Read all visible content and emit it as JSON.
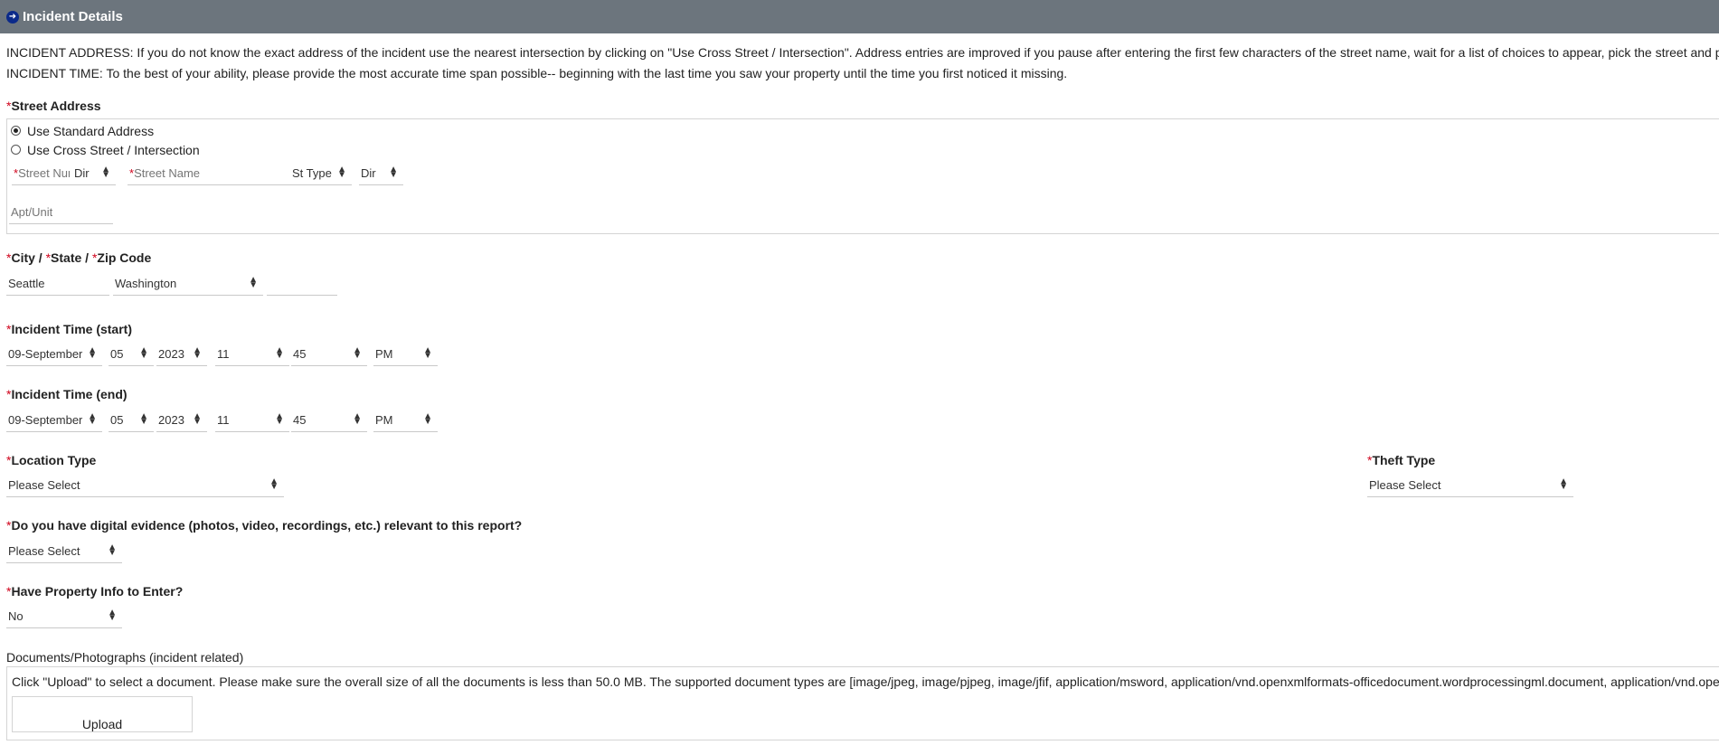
{
  "section": {
    "title": "Incident Details",
    "icon": "arrow-right-circle-icon"
  },
  "instructions": {
    "address": "INCIDENT ADDRESS: If you do not know the exact address of the incident use the nearest intersection by clicking on \"Use Cross Street / Intersection\". Address entries are improved if you pause after entering the first few characters of the street name, wait for a list of choices to appear, pick the street and press ENTER.",
    "time": "INCIDENT TIME: To the best of your ability, please provide the most accurate time span possible-- beginning with the last time you saw your property until the time you first noticed it missing."
  },
  "required_marker": "*",
  "street_address": {
    "label": "Street Address",
    "options": [
      {
        "label": "Use Standard Address",
        "selected": true
      },
      {
        "label": "Use Cross Street / Intersection",
        "selected": false
      }
    ],
    "street_num_placeholder": "Street Number",
    "dir_prefix": "Dir",
    "street_name_placeholder": "Street Name",
    "st_type": "St Type",
    "dir_suffix": "Dir",
    "apt_placeholder": "Apt/Unit"
  },
  "city_state_zip": {
    "label_city": "City / ",
    "label_state": "State / ",
    "label_zip": "Zip Code",
    "city": "Seattle",
    "state": "Washington",
    "zip": ""
  },
  "time_start": {
    "label": "Incident Time (start)",
    "month": "09-September",
    "day": "05",
    "year": "2023",
    "hour": "11",
    "minute": "45",
    "ampm": "PM"
  },
  "time_end": {
    "label": "Incident Time (end)",
    "month": "09-September",
    "day": "05",
    "year": "2023",
    "hour": "11",
    "minute": "45",
    "ampm": "PM"
  },
  "location_type": {
    "label": "Location Type",
    "value": "Please Select"
  },
  "theft_type": {
    "label": "Theft Type",
    "value": "Please Select"
  },
  "digital_evidence": {
    "label": "Do you have digital evidence (photos, video, recordings, etc.) relevant to this report?",
    "value": "Please Select"
  },
  "property_info": {
    "label": "Have Property Info to Enter?",
    "value": "No"
  },
  "documents": {
    "label": "Documents/Photographs (incident related)",
    "text": "Click \"Upload\" to select a document. Please make sure the overall size of all the documents is less than 50.0 MB. The supported document types are [image/jpeg, image/pjpeg, image/jfif, application/msword, application/vnd.openxmlformats-officedocument.wordprocessingml.document, application/vnd.openxmlformats-officedocument.spreadsheetml.sheet]",
    "upload_label": "Upload"
  },
  "colors": {
    "header_bg": "#6c757d",
    "required": "#d0021b",
    "icon_bg": "#0b2a8a"
  }
}
